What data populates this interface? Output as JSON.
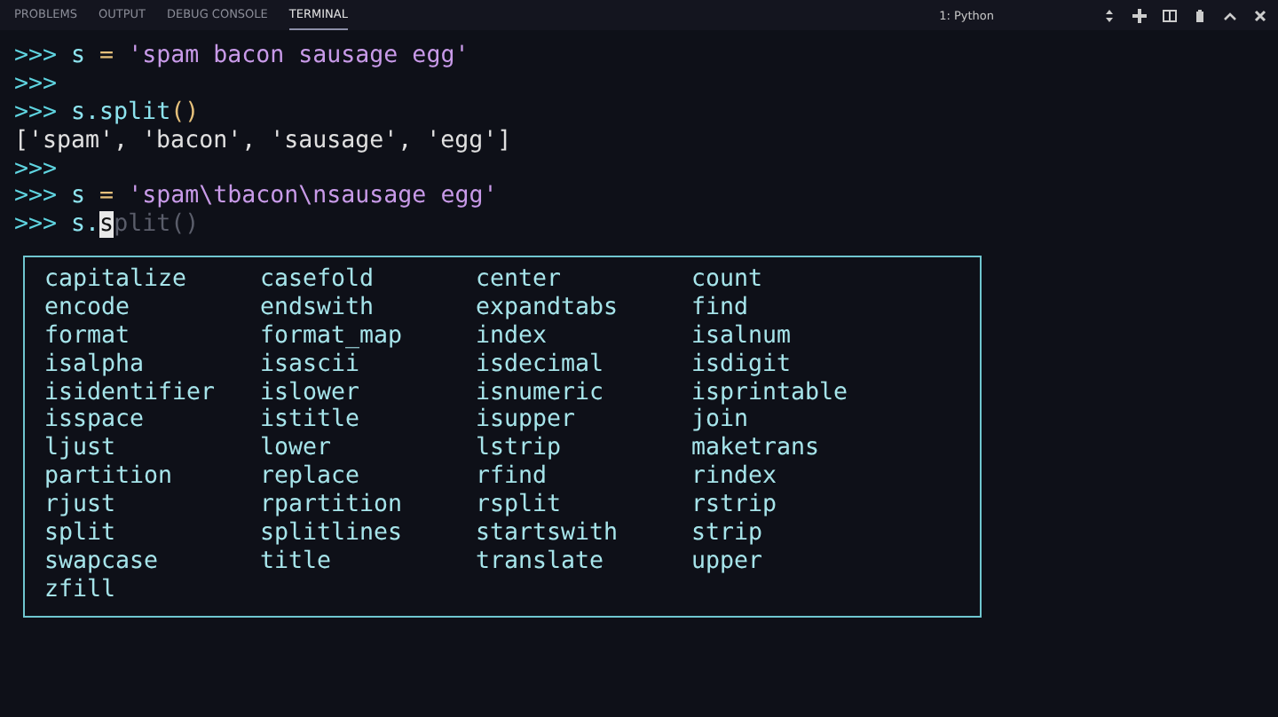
{
  "panel_tabs": [
    {
      "label": "PROBLEMS",
      "selected": false
    },
    {
      "label": "OUTPUT",
      "selected": false
    },
    {
      "label": "DEBUG CONSOLE",
      "selected": false
    },
    {
      "label": "TERMINAL",
      "selected": true
    }
  ],
  "terminal_selector": {
    "value": "1: Python"
  },
  "terminal_lines": [
    [
      {
        "kind": "prompt",
        "text": ">>> "
      },
      {
        "kind": "name",
        "text": "s"
      },
      {
        "kind": "op",
        "text": " = "
      },
      {
        "kind": "string",
        "text": "'spam bacon sausage egg'"
      }
    ],
    [
      {
        "kind": "prompt",
        "text": ">>>"
      }
    ],
    [
      {
        "kind": "prompt",
        "text": ">>> "
      },
      {
        "kind": "name",
        "text": "s.split"
      },
      {
        "kind": "op",
        "text": "()"
      }
    ],
    [
      {
        "kind": "output",
        "text": "['spam', 'bacon', 'sausage', 'egg']"
      }
    ],
    [
      {
        "kind": "prompt",
        "text": ">>>"
      }
    ],
    [
      {
        "kind": "prompt",
        "text": ">>> "
      },
      {
        "kind": "name",
        "text": "s"
      },
      {
        "kind": "op",
        "text": " = "
      },
      {
        "kind": "string",
        "text": "'spam\\tbacon\\nsausage egg'"
      }
    ],
    [
      {
        "kind": "prompt",
        "text": ">>> "
      },
      {
        "kind": "name",
        "text": "s."
      },
      {
        "kind": "cursor",
        "text": "s"
      },
      {
        "kind": "ghost",
        "text": "plit()"
      }
    ]
  ],
  "completions": [
    "capitalize",
    "casefold",
    "center",
    "count",
    "encode",
    "endswith",
    "expandtabs",
    "find",
    "format",
    "format_map",
    "index",
    "isalnum",
    "isalpha",
    "isascii",
    "isdecimal",
    "isdigit",
    "isidentifier",
    "islower",
    "isnumeric",
    "isprintable",
    "isspace",
    "istitle",
    "isupper",
    "join",
    "ljust",
    "lower",
    "lstrip",
    "maketrans",
    "partition",
    "replace",
    "rfind",
    "rindex",
    "rjust",
    "rpartition",
    "rsplit",
    "rstrip",
    "split",
    "splitlines",
    "startswith",
    "strip",
    "swapcase",
    "title",
    "translate",
    "upper",
    "zfill"
  ]
}
